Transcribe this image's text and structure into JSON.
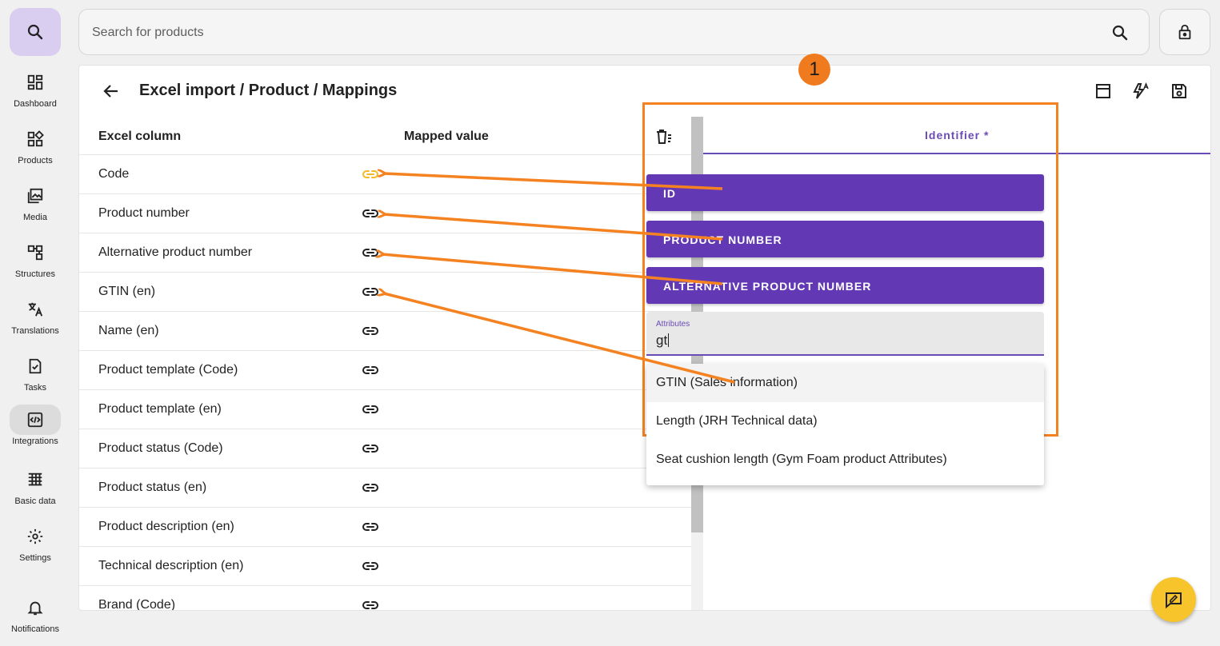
{
  "sidebar": {
    "items": [
      {
        "label": "Dashboard",
        "icon": "dashboard-icon"
      },
      {
        "label": "Products",
        "icon": "products-icon"
      },
      {
        "label": "Media",
        "icon": "media-icon"
      },
      {
        "label": "Structures",
        "icon": "structures-icon"
      },
      {
        "label": "Translations",
        "icon": "translate-icon"
      },
      {
        "label": "Tasks",
        "icon": "tasks-icon"
      },
      {
        "label": "Integrations",
        "icon": "integrations-icon",
        "active": true
      },
      {
        "label": "Basic data",
        "icon": "basic-data-icon"
      },
      {
        "label": "Settings",
        "icon": "settings-icon"
      },
      {
        "label": "Notifications",
        "icon": "bell-icon"
      }
    ]
  },
  "search": {
    "placeholder": "Search for products",
    "value": ""
  },
  "header": {
    "title": "Excel import / Product / Mappings"
  },
  "table": {
    "col_excel": "Excel column",
    "col_mapped": "Mapped value",
    "rows": [
      {
        "name": "Code",
        "link_active": true
      },
      {
        "name": "Product number"
      },
      {
        "name": "Alternative product number"
      },
      {
        "name": "GTIN (en)"
      },
      {
        "name": "Name (en)"
      },
      {
        "name": "Product template (Code)"
      },
      {
        "name": "Product template (en)"
      },
      {
        "name": "Product status (Code)"
      },
      {
        "name": "Product status (en)"
      },
      {
        "name": "Product description (en)"
      },
      {
        "name": "Technical description (en)"
      },
      {
        "name": "Brand (Code)"
      }
    ]
  },
  "right": {
    "tab_label": "Identifier *",
    "badge": "1",
    "buttons": [
      "ID",
      "PRODUCT NUMBER",
      "ALTERNATIVE PRODUCT NUMBER"
    ],
    "attr_label": "Attributes",
    "attr_value": "gt",
    "options": [
      "GTIN (Sales information)",
      "Length (JRH Technical data)",
      "Seat cushion length (Gym Foam product Attributes)"
    ]
  },
  "colors": {
    "accent": "#6238b4",
    "annotation": "#f58220",
    "fab": "#f8c42c",
    "link_active": "#f2b928"
  }
}
